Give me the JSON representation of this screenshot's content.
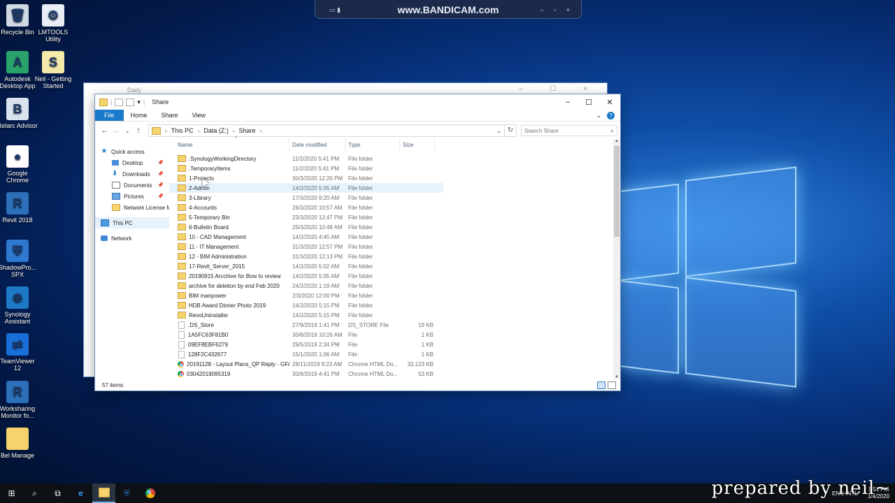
{
  "bandicam": {
    "text": "www.BANDICAM.com"
  },
  "desktop_icons": [
    {
      "label": "Recycle Bin",
      "glyph": "🗑",
      "color": "#cfd8e3"
    },
    {
      "label": "LMTOOLS Utility",
      "glyph": "⚙",
      "color": "#e9eef5"
    },
    {
      "label": "Autodesk Desktop App",
      "glyph": "A",
      "color": "#2aa36b"
    },
    {
      "label": "Neil - Getting Started",
      "glyph": "S",
      "color": "#f4e9a8"
    },
    {
      "label": "Belarc Advisor",
      "glyph": "B",
      "color": "#d9e4ef"
    },
    {
      "label": "Google Chrome",
      "glyph": "●",
      "color": "#ffffff"
    },
    {
      "label": "Revit 2018",
      "glyph": "R",
      "color": "#2d6fb8"
    },
    {
      "label": "ShadowPro... SPX",
      "glyph": "⛨",
      "color": "#2f78d0"
    },
    {
      "label": "Synology Assistant",
      "glyph": "⊕",
      "color": "#1d79c5"
    },
    {
      "label": "TeamViewer 12",
      "glyph": "⇄",
      "color": "#1a6ed8"
    },
    {
      "label": "Worksharing Monitor fo...",
      "glyph": "R",
      "color": "#2d6fb8"
    },
    {
      "label": "Bel Manage",
      "glyph": "",
      "color": "#f6d46b"
    }
  ],
  "back_window": {
    "title": "Daily"
  },
  "window": {
    "title": "Share",
    "ribbon_tabs": [
      "File",
      "Home",
      "Share",
      "View"
    ],
    "address": [
      "This PC",
      "Data (Z:)",
      "Share"
    ],
    "search_placeholder": "Search Share",
    "nav": {
      "quick_access": "Quick access",
      "items": [
        "Desktop",
        "Downloads",
        "Documents",
        "Pictures",
        "Network License M"
      ],
      "this_pc": "This PC",
      "network": "Network"
    },
    "columns": [
      "Name",
      "Date modified",
      "Type",
      "Size"
    ],
    "rows": [
      {
        "name": ".SynologyWorkingDirectory",
        "date": "11/2/2020 5:41 PM",
        "type": "File folder",
        "size": "",
        "icon": "folder"
      },
      {
        "name": ".TemporaryItems",
        "date": "11/2/2020 5:41 PM",
        "type": "File folder",
        "size": "",
        "icon": "folder"
      },
      {
        "name": "1-Projects",
        "date": "30/3/2020 12:20 PM",
        "type": "File folder",
        "size": "",
        "icon": "folder"
      },
      {
        "name": "2-Admin",
        "date": "14/2/2020 5:05 AM",
        "type": "File folder",
        "size": "",
        "icon": "folder"
      },
      {
        "name": "3-Library",
        "date": "17/3/2020 9:20 AM",
        "type": "File folder",
        "size": "",
        "icon": "folder"
      },
      {
        "name": "4-Accounts",
        "date": "26/3/2020 10:57 AM",
        "type": "File folder",
        "size": "",
        "icon": "folder"
      },
      {
        "name": "5-Temporary Bin",
        "date": "23/3/2020 12:47 PM",
        "type": "File folder",
        "size": "",
        "icon": "folder"
      },
      {
        "name": "6-Bulletin Board",
        "date": "25/3/2020 10:48 AM",
        "type": "File folder",
        "size": "",
        "icon": "folder"
      },
      {
        "name": "10 - CAD Management",
        "date": "14/2/2020 4:45 AM",
        "type": "File folder",
        "size": "",
        "icon": "folder"
      },
      {
        "name": "11 - IT Management",
        "date": "31/3/2020 12:57 PM",
        "type": "File folder",
        "size": "",
        "icon": "folder"
      },
      {
        "name": "12 - BIM Administration",
        "date": "31/3/2020 12:13 PM",
        "type": "File folder",
        "size": "",
        "icon": "folder"
      },
      {
        "name": "17-Revit_Server_2015",
        "date": "14/2/2020 5:02 AM",
        "type": "File folder",
        "size": "",
        "icon": "folder"
      },
      {
        "name": "20190915 Arcchive for Bow to review",
        "date": "14/2/2020 5:05 AM",
        "type": "File folder",
        "size": "",
        "icon": "folder"
      },
      {
        "name": "archive for deletion by end Feb 2020",
        "date": "24/2/2020 1:19 AM",
        "type": "File folder",
        "size": "",
        "icon": "folder"
      },
      {
        "name": "BIM manpower",
        "date": "2/3/2020 12:00 PM",
        "type": "File folder",
        "size": "",
        "icon": "folder"
      },
      {
        "name": "HDB Award Dinner Photo 2019",
        "date": "14/2/2020 5:15 PM",
        "type": "File folder",
        "size": "",
        "icon": "folder"
      },
      {
        "name": "RevoUninstaller",
        "date": "14/2/2020 5:15 PM",
        "type": "File folder",
        "size": "",
        "icon": "folder"
      },
      {
        "name": ".DS_Store",
        "date": "27/9/2019 1:41 PM",
        "type": "DS_STORE File",
        "size": "19 KB",
        "icon": "file"
      },
      {
        "name": "1A5FC63F81B0",
        "date": "30/8/2019 10:26 AM",
        "type": "File",
        "size": "1 KB",
        "icon": "file"
      },
      {
        "name": "09EF8EBF6279",
        "date": "29/5/2019 2:34 PM",
        "type": "File",
        "size": "1 KB",
        "icon": "file"
      },
      {
        "name": "128F2C432677",
        "date": "15/1/2020 1:06 AM",
        "type": "File",
        "size": "1 KB",
        "icon": "file"
      },
      {
        "name": "20191128 - Layout Plans_QP Reply - GFA ...",
        "date": "28/11/2019 9:23 AM",
        "type": "Chrome HTML Do...",
        "size": "32,123 KB",
        "icon": "chrome"
      },
      {
        "name": "03042019095319",
        "date": "30/8/2019 4:41 PM",
        "type": "Chrome HTML Do...",
        "size": "53 KB",
        "icon": "chrome"
      }
    ],
    "highlight_row": 3,
    "status": "57 items"
  },
  "edge_number": "72",
  "tray": {
    "lang": "ENG INTL",
    "time": "1:51 PM",
    "date": "1/4/2020"
  },
  "watermark": "prepared by neil~"
}
